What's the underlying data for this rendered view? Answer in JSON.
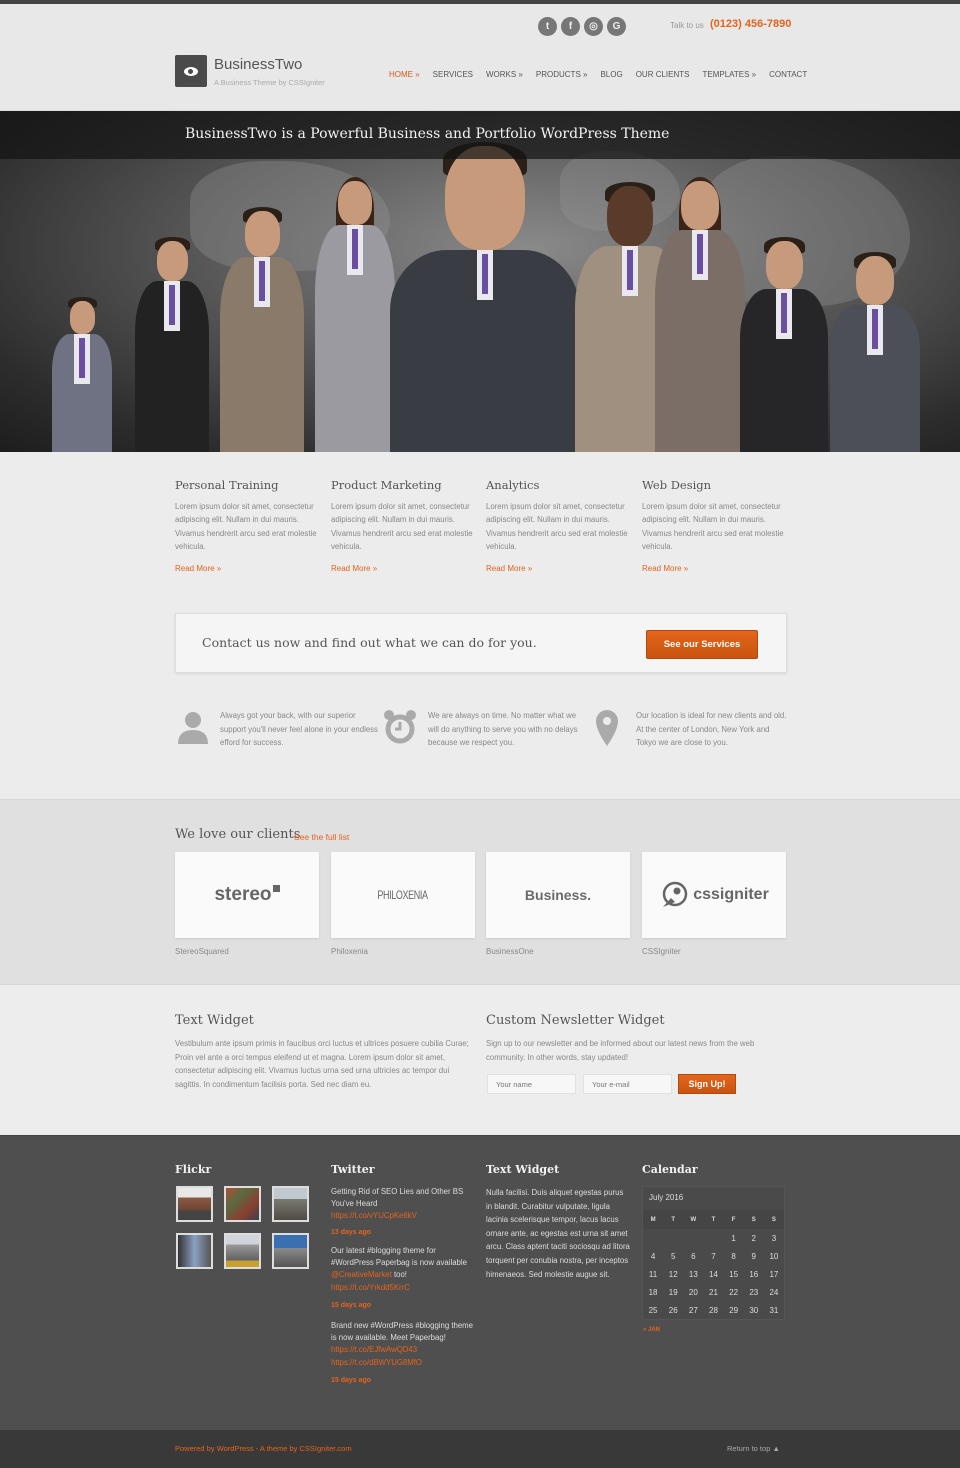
{
  "header": {
    "social": [
      {
        "icon": "twitter-icon",
        "glyph": "t"
      },
      {
        "icon": "facebook-icon",
        "glyph": "f"
      },
      {
        "icon": "instagram-icon",
        "glyph": "◎"
      },
      {
        "icon": "google-icon",
        "glyph": "G"
      }
    ],
    "talk_label": "Talk to us",
    "phone": "(0123) 456-7890",
    "logo_title": "BusinessTwo",
    "logo_subtitle": "A Business Theme by CSSIgniter",
    "nav": [
      {
        "label": "HOME »",
        "active": true
      },
      {
        "label": "SERVICES",
        "active": false
      },
      {
        "label": "WORKS »",
        "active": false
      },
      {
        "label": "PRODUCTS »",
        "active": false
      },
      {
        "label": "BLOG",
        "active": false
      },
      {
        "label": "OUR CLIENTS",
        "active": false
      },
      {
        "label": "TEMPLATES »",
        "active": false
      },
      {
        "label": "CONTACT",
        "active": false
      }
    ]
  },
  "hero": {
    "title": "BusinessTwo is a Powerful Business and Portfolio WordPress Theme"
  },
  "services": [
    {
      "title": "Personal Training",
      "text": "Lorem ipsum dolor sit amet, consectetur adipiscing elit. Nullam in dui mauris. Vivamus hendrerit arcu sed erat molestie vehicula.",
      "link": "Read More »"
    },
    {
      "title": "Product Marketing",
      "text": "Lorem ipsum dolor sit amet, consectetur adipiscing elit. Nullam in dui mauris. Vivamus hendrerit arcu sed erat molestie vehicula.",
      "link": "Read More »"
    },
    {
      "title": "Analytics",
      "text": "Lorem ipsum dolor sit amet, consectetur adipiscing elit. Nullam in dui mauris. Vivamus hendrerit arcu sed erat molestie vehicula.",
      "link": "Read More »"
    },
    {
      "title": "Web Design",
      "text": "Lorem ipsum dolor sit amet, consectetur adipiscing elit. Nullam in dui mauris. Vivamus hendrerit arcu sed erat molestie vehicula.",
      "link": "Read More »"
    }
  ],
  "cta": {
    "text": "Contact us now and find out what we can do for you.",
    "button": "See our Services"
  },
  "features": [
    {
      "icon": "user-icon",
      "text": "Always got your back, with our superior support you'll never feel alone in your endless efford for success."
    },
    {
      "icon": "alarm-clock-icon",
      "text": "We are always on time. No matter what we will do anything to serve you with no delays because we respect you."
    },
    {
      "icon": "map-pin-icon",
      "text": "Our location is ideal for new clients and old. At the center of London, New York and Tokyo we are close to you."
    }
  ],
  "clients": {
    "title": "We love our clients",
    "see_all": "See the full list",
    "items": [
      {
        "logo": "stereo",
        "name": "StereoSquared"
      },
      {
        "logo": "PHILOXENIA",
        "name": "Philoxenia"
      },
      {
        "logo": "Business.",
        "name": "BusinessOne"
      },
      {
        "logo": "cssigniter",
        "name": "CSSIgniter"
      }
    ]
  },
  "widgets": {
    "text_title": "Text Widget",
    "text_body": "Vestibulum ante ipsum primis in faucibus orci luctus et ultrices posuere cubilia Curae; Proin vel ante a orci tempus eleifend ut et magna. Lorem ipsum dolor sit amet, consectetur adipiscing elit. Vivamus luctus urna sed urna ultricies ac tempor dui sagittis. In condimentum facilisis porta. Sed nec diam eu.",
    "newsletter_title": "Custom Newsletter Widget",
    "newsletter_body": "Sign up to our newsletter and be informed about our latest news from the web community. In other words, stay updated!",
    "name_placeholder": "Your name",
    "email_placeholder": "Your e-mail",
    "signup_button": "Sign Up!"
  },
  "footer": {
    "flickr_title": "Flickr",
    "twitter_title": "Twitter",
    "tweets": [
      {
        "text": "Getting Rid of SEO Lies and Other BS You've Heard",
        "links": [
          "https://t.co/vYUCpKe6kV"
        ],
        "age": "13 days ago"
      },
      {
        "text": "Our latest #blogging theme for #WordPress Paperbag is now available",
        "mention": "@CreativeMarket",
        "tail": "too!",
        "links": [
          "https://t.co/Yrkdd5KrrC"
        ],
        "age": "15 days ago"
      },
      {
        "text": "Brand new #WordPress #blogging theme is now available. Meet Paperbag!",
        "inline_link": "https://t.co/EJfwAwQD43",
        "links": [
          "https://t.co/dBWYUG8MfO"
        ],
        "age": "15 days ago"
      }
    ],
    "text_title": "Text Widget",
    "text_body": "Nulla facilisi. Duis aliquet egestas purus in blandit. Curabitur vulputate, ligula lacinia scelerisque tempor, lacus lacus ornare ante, ac egestas est urna sit amet arcu. Class aptent taciti sociosqu ad litora torquent per conubia nostra, per inceptos himenaeos. Sed molestie augue sit.",
    "calendar_title": "Calendar",
    "calendar": {
      "caption": "July 2016",
      "days": [
        "M",
        "T",
        "W",
        "T",
        "F",
        "S",
        "S"
      ],
      "weeks": [
        [
          "",
          "",
          "",
          "",
          "1",
          "2",
          "3"
        ],
        [
          "4",
          "5",
          "6",
          "7",
          "8",
          "9",
          "10"
        ],
        [
          "11",
          "12",
          "13",
          "14",
          "15",
          "16",
          "17"
        ],
        [
          "18",
          "19",
          "20",
          "21",
          "22",
          "23",
          "24"
        ],
        [
          "25",
          "26",
          "27",
          "28",
          "29",
          "30",
          "31"
        ]
      ],
      "prev": "« JAN"
    }
  },
  "bottom": {
    "credits": "Powered by WordPress - A theme by CSSIgniter.com",
    "return_top": "Return to top ▲"
  }
}
